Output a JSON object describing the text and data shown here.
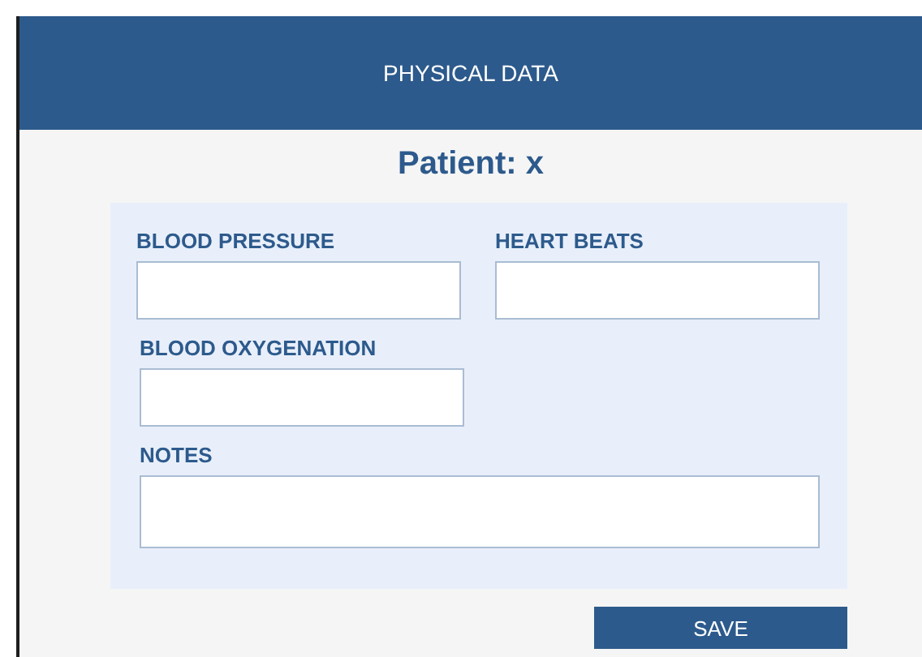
{
  "header": {
    "title": "PHYSICAL DATA"
  },
  "patient_title": "Patient: x",
  "fields": [
    {
      "label": "BLOOD PRESSURE",
      "kind": "input"
    },
    {
      "label": "HEART BEATS",
      "kind": "input"
    },
    {
      "label": "BLOOD OXYGENATION",
      "kind": "input"
    },
    {
      "label": "NOTES",
      "kind": "textarea"
    }
  ],
  "buttons": [
    {
      "label": "SAVE"
    }
  ]
}
